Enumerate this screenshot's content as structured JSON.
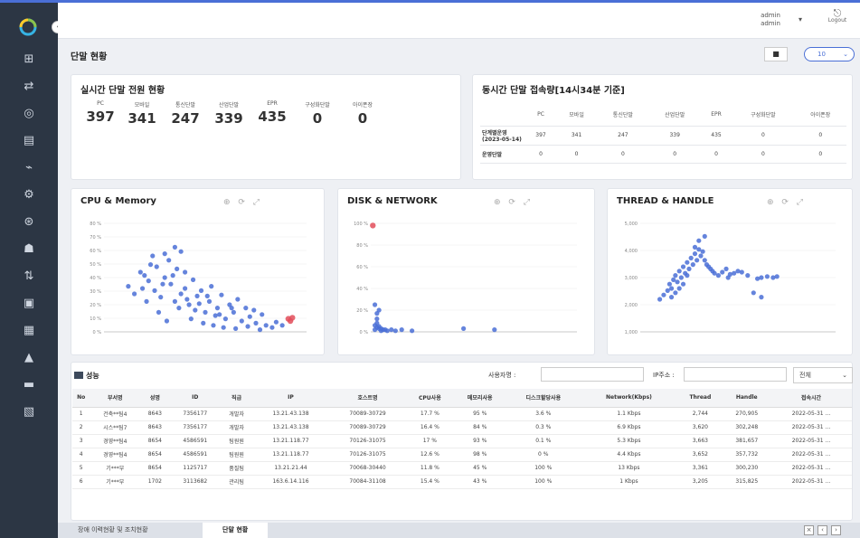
{
  "header": {
    "user_name": "admin",
    "user_role": "admin",
    "user_dropdown": "▾",
    "logout_label": "Logout"
  },
  "page": {
    "title": "단말 현황",
    "refresh_label": "10",
    "stop_label": "■"
  },
  "realtime": {
    "title": "실시간 단말 전원 현황",
    "stats": [
      {
        "label": "PC",
        "value": "397"
      },
      {
        "label": "모바일",
        "value": "341"
      },
      {
        "label": "통신단말",
        "value": "247"
      },
      {
        "label": "산업단말",
        "value": "339"
      },
      {
        "label": "EPR",
        "value": "435"
      },
      {
        "label": "구성화단말",
        "value": "0"
      },
      {
        "label": "아이폰장",
        "value": "0"
      }
    ]
  },
  "concurrent": {
    "title": "동시간 단말 접속량[14시34분 기준]",
    "headers": [
      "",
      "PC",
      "모바일",
      "통신단말",
      "산업단말",
      "EPR",
      "구성화단말",
      "아이폰장"
    ],
    "rows": [
      {
        "label": "단계별운영(2023-05-14)",
        "values": [
          "397",
          "341",
          "247",
          "339",
          "435",
          "0",
          "0"
        ]
      },
      {
        "label": "운영단말",
        "values": [
          "0",
          "0",
          "0",
          "0",
          "0",
          "0",
          "0"
        ]
      }
    ]
  },
  "charts_meta": {
    "cpu": {
      "title": "CPU & Memory"
    },
    "disk": {
      "title": "DISK & NETWORK"
    },
    "thread": {
      "title": "THREAD & HANDLE"
    },
    "toolbar_icons": [
      "zoom-icon",
      "refresh-icon",
      "expand-icon"
    ]
  },
  "chart_data": [
    {
      "type": "scatter",
      "title": "CPU & Memory",
      "xlim": [
        0,
        100
      ],
      "ylim": [
        0,
        100
      ],
      "yticks": [
        "0 %",
        "10 %",
        "20 %",
        "30 %",
        "40 %",
        "50 %",
        "60 %",
        "70 %",
        "80 %"
      ],
      "series": [
        {
          "color": "#4a6fd6",
          "points": [
            [
              12,
              42
            ],
            [
              18,
              55
            ],
            [
              22,
              47
            ],
            [
              25,
              38
            ],
            [
              26,
              60
            ],
            [
              28,
              32
            ],
            [
              30,
              50
            ],
            [
              33,
              44
            ],
            [
              35,
              28
            ],
            [
              36,
              58
            ],
            [
              38,
              35
            ],
            [
              40,
              40
            ],
            [
              42,
              25
            ],
            [
              44,
              48
            ],
            [
              45,
              20
            ],
            [
              46,
              33
            ],
            [
              48,
              38
            ],
            [
              50,
              18
            ],
            [
              52,
              28
            ],
            [
              53,
              42
            ],
            [
              55,
              15
            ],
            [
              56,
              22
            ],
            [
              58,
              34
            ],
            [
              60,
              12
            ],
            [
              62,
              25
            ],
            [
              64,
              18
            ],
            [
              66,
              30
            ],
            [
              68,
              10
            ],
            [
              70,
              22
            ],
            [
              72,
              14
            ],
            [
              74,
              20
            ],
            [
              75,
              8
            ],
            [
              78,
              16
            ],
            [
              80,
              6
            ],
            [
              32,
              66
            ],
            [
              24,
              70
            ],
            [
              20,
              52
            ],
            [
              15,
              35
            ],
            [
              40,
              55
            ],
            [
              34,
              52
            ],
            [
              29,
              44
            ],
            [
              47,
              26
            ],
            [
              51,
              33
            ],
            [
              57,
              16
            ],
            [
              63,
              22
            ],
            [
              41,
              30
            ],
            [
              37,
              22
            ],
            [
              43,
              12
            ],
            [
              49,
              8
            ],
            [
              54,
              6
            ],
            [
              59,
              4
            ],
            [
              65,
              3
            ],
            [
              71,
              5
            ],
            [
              77,
              2
            ],
            [
              83,
              4
            ],
            [
              85,
              9
            ],
            [
              88,
              6
            ],
            [
              27,
              18
            ],
            [
              31,
              10
            ],
            [
              21,
              28
            ],
            [
              19,
              40
            ],
            [
              23,
              62
            ],
            [
              30,
              72
            ],
            [
              35,
              78
            ],
            [
              38,
              74
            ]
          ]
        },
        {
          "color": "#e24d5a",
          "points": [
            [
              91,
              12
            ],
            [
              92,
              10
            ],
            [
              93,
              13
            ]
          ]
        }
      ]
    },
    {
      "type": "scatter",
      "title": "DISK & NETWORK",
      "xlim": [
        0,
        100
      ],
      "ylim": [
        0,
        100
      ],
      "yticks": [
        "0 %",
        "20 %",
        "40 %",
        "60 %",
        "80 %",
        "100 %"
      ],
      "series": [
        {
          "color": "#4a6fd6",
          "points": [
            [
              2,
              2
            ],
            [
              3,
              4
            ],
            [
              4,
              3
            ],
            [
              5,
              1
            ],
            [
              6,
              2
            ],
            [
              2,
              6
            ],
            [
              3,
              8
            ],
            [
              4,
              5
            ],
            [
              5,
              3
            ],
            [
              7,
              2
            ],
            [
              8,
              1
            ],
            [
              10,
              2
            ],
            [
              12,
              1
            ],
            [
              15,
              2
            ],
            [
              20,
              1
            ],
            [
              3,
              12
            ],
            [
              4,
              20
            ],
            [
              3,
              17
            ],
            [
              2,
              25
            ],
            [
              45,
              3
            ],
            [
              60,
              2
            ]
          ]
        },
        {
          "color": "#e24d5a",
          "points": [
            [
              1,
              98
            ]
          ]
        }
      ]
    },
    {
      "type": "scatter",
      "title": "THREAD & HANDLE",
      "xlim": [
        0,
        100
      ],
      "ylim": [
        0,
        5000
      ],
      "yticks": [
        "1,000",
        "2,000",
        "3,000",
        "4,000",
        "5,000"
      ],
      "series": [
        {
          "color": "#4a6fd6",
          "points": [
            [
              10,
              1500
            ],
            [
              12,
              1700
            ],
            [
              14,
              1900
            ],
            [
              15,
              2200
            ],
            [
              16,
              2000
            ],
            [
              17,
              2400
            ],
            [
              18,
              2600
            ],
            [
              19,
              2300
            ],
            [
              20,
              2800
            ],
            [
              21,
              2500
            ],
            [
              22,
              3000
            ],
            [
              23,
              2700
            ],
            [
              24,
              3200
            ],
            [
              25,
              2900
            ],
            [
              26,
              3400
            ],
            [
              27,
              3100
            ],
            [
              28,
              3600
            ],
            [
              29,
              3300
            ],
            [
              30,
              3800
            ],
            [
              31,
              3500
            ],
            [
              32,
              3700
            ],
            [
              33,
              3300
            ],
            [
              34,
              3100
            ],
            [
              35,
              3000
            ],
            [
              36,
              2900
            ],
            [
              37,
              2800
            ],
            [
              38,
              2700
            ],
            [
              40,
              2600
            ],
            [
              42,
              2750
            ],
            [
              44,
              2900
            ],
            [
              45,
              2500
            ],
            [
              46,
              2650
            ],
            [
              48,
              2700
            ],
            [
              50,
              2800
            ],
            [
              52,
              2750
            ],
            [
              55,
              2600
            ],
            [
              60,
              2450
            ],
            [
              62,
              2500
            ],
            [
              65,
              2550
            ],
            [
              68,
              2500
            ],
            [
              70,
              2550
            ],
            [
              58,
              1800
            ],
            [
              62,
              1600
            ],
            [
              20,
              2000
            ],
            [
              18,
              1800
            ],
            [
              16,
              1600
            ],
            [
              22,
              2200
            ],
            [
              24,
              2600
            ],
            [
              28,
              3900
            ],
            [
              30,
              4200
            ],
            [
              33,
              4400
            ]
          ]
        }
      ]
    }
  ],
  "bottom": {
    "title": "성능",
    "filter_user_label": "사용자명 :",
    "filter_user_value": "",
    "filter_ip_label": "IP주소 :",
    "filter_ip_value": "",
    "select_value": "전체"
  },
  "perf_table": {
    "headers": [
      "No",
      "부서명",
      "성명",
      "ID",
      "직급",
      "IP",
      "호스트명",
      "CPU사용",
      "메모리사용",
      "디스크할당사용",
      "Network(Kbps)",
      "Thread",
      "Handle",
      "접속시간"
    ],
    "rows": [
      [
        "1",
        "건축**팀4",
        "8643",
        "7356177",
        "개발자",
        "13.21.43.138",
        "70089-30729",
        "17.7 %",
        "95 %",
        "3.6 %",
        "1.1 Kbps",
        "2,744",
        "270,905",
        "2022-05-31 ..."
      ],
      [
        "2",
        "시스**팀7",
        "8643",
        "7356177",
        "개발자",
        "13.21.43.138",
        "70089-30729",
        "16.4 %",
        "84 %",
        "0.3 %",
        "6.9 Kbps",
        "3,620",
        "302,248",
        "2022-05-31 ..."
      ],
      [
        "3",
        "경영**팀4",
        "8654",
        "4586591",
        "팀원원",
        "13.21.118.77",
        "70126-31075",
        "17 %",
        "93 %",
        "0.1 %",
        "5.3 Kbps",
        "3,663",
        "381,657",
        "2022-05-31 ..."
      ],
      [
        "4",
        "경영**팀4",
        "8654",
        "4586591",
        "팀원원",
        "13.21.118.77",
        "70126-31075",
        "12.6 %",
        "98 %",
        "0 %",
        "4.4 Kbps",
        "3,652",
        "357,732",
        "2022-05-31 ..."
      ],
      [
        "5",
        "기***부",
        "8654",
        "1125717",
        "품질팀",
        "13.21.21.44",
        "70068-30440",
        "11.8 %",
        "45 %",
        "100 %",
        "13 Kbps",
        "3,361",
        "300,230",
        "2022-05-31 ..."
      ],
      [
        "6",
        "기***부",
        "1702",
        "3113682",
        "관리팀",
        "163.6.14.116",
        "70084-31108",
        "15.4 %",
        "43 %",
        "100 %",
        "1 Kbps",
        "3,205",
        "315,825",
        "2022-05-31 ..."
      ]
    ]
  },
  "tabs": [
    {
      "label": "장애 이력현황 및 조치현황",
      "active": false
    },
    {
      "label": "단말 현황",
      "active": true
    }
  ],
  "tab_controls": [
    "×",
    "‹",
    "›"
  ]
}
